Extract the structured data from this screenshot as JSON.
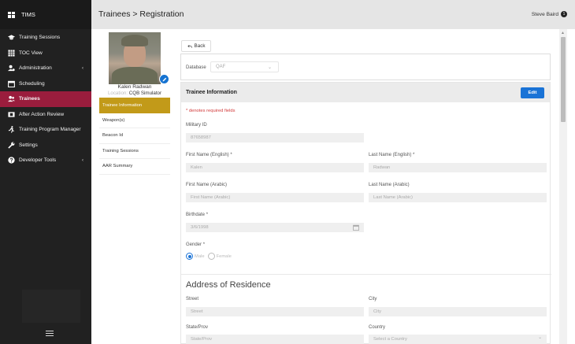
{
  "app": {
    "brand": "TIMS"
  },
  "header": {
    "title": "Trainees > Registration",
    "user": "Steve Baird",
    "user_badge": "1"
  },
  "sidebar": {
    "items": [
      {
        "label": "Training Sessions",
        "icon": "graduation-cap-icon"
      },
      {
        "label": "TOC View",
        "icon": "grid-icon"
      },
      {
        "label": "Administration",
        "icon": "users-cog-icon",
        "caret": "‹"
      },
      {
        "label": "Scheduling",
        "icon": "calendar-icon"
      },
      {
        "label": "Trainees",
        "icon": "user-group-icon",
        "active": true
      },
      {
        "label": "After Action Review",
        "icon": "film-icon"
      },
      {
        "label": "Training Program Manager",
        "icon": "running-icon"
      },
      {
        "label": "Settings",
        "icon": "wrench-icon"
      },
      {
        "label": "Developer Tools",
        "icon": "help-icon",
        "caret": "‹"
      }
    ]
  },
  "profile": {
    "name": "Kalen Radwan",
    "location_label": "Location:",
    "location": "CQB Simulator",
    "menu": [
      "Trainee Information",
      "Weapon(s)",
      "Beacon Id",
      "Training Sessions",
      "AAR Summary"
    ]
  },
  "toolbar": {
    "back_label": "Back"
  },
  "database": {
    "label": "Database",
    "value": "QAF"
  },
  "card": {
    "title": "Trainee Information",
    "edit_label": "Edit",
    "required_note": "* denotes required fields"
  },
  "form": {
    "military_id": {
      "label": "Military ID",
      "value": "87658987"
    },
    "first_name_en": {
      "label": "First Name (English)",
      "required": "*",
      "value": "Kalen"
    },
    "last_name_en": {
      "label": "Last Name (English)",
      "required": "*",
      "value": "Radwan"
    },
    "first_name_ar": {
      "label": "First Name (Arabic)",
      "placeholder": "First Name (Arabic)"
    },
    "last_name_ar": {
      "label": "Last Name (Arabic)",
      "placeholder": "Last Name (Arabic)"
    },
    "birthdate": {
      "label": "Birthdate",
      "required": "*",
      "value": "3/6/1998"
    },
    "gender": {
      "label": "Gender",
      "required": "*",
      "options": [
        "Male",
        "Female"
      ],
      "selected": "Male"
    }
  },
  "address": {
    "title": "Address of Residence",
    "street": {
      "label": "Street",
      "placeholder": "Street"
    },
    "city": {
      "label": "City",
      "placeholder": "City"
    },
    "state": {
      "label": "State/Prov",
      "placeholder": "State/Prov"
    },
    "country": {
      "label": "Country",
      "placeholder": "Select a Country"
    }
  }
}
